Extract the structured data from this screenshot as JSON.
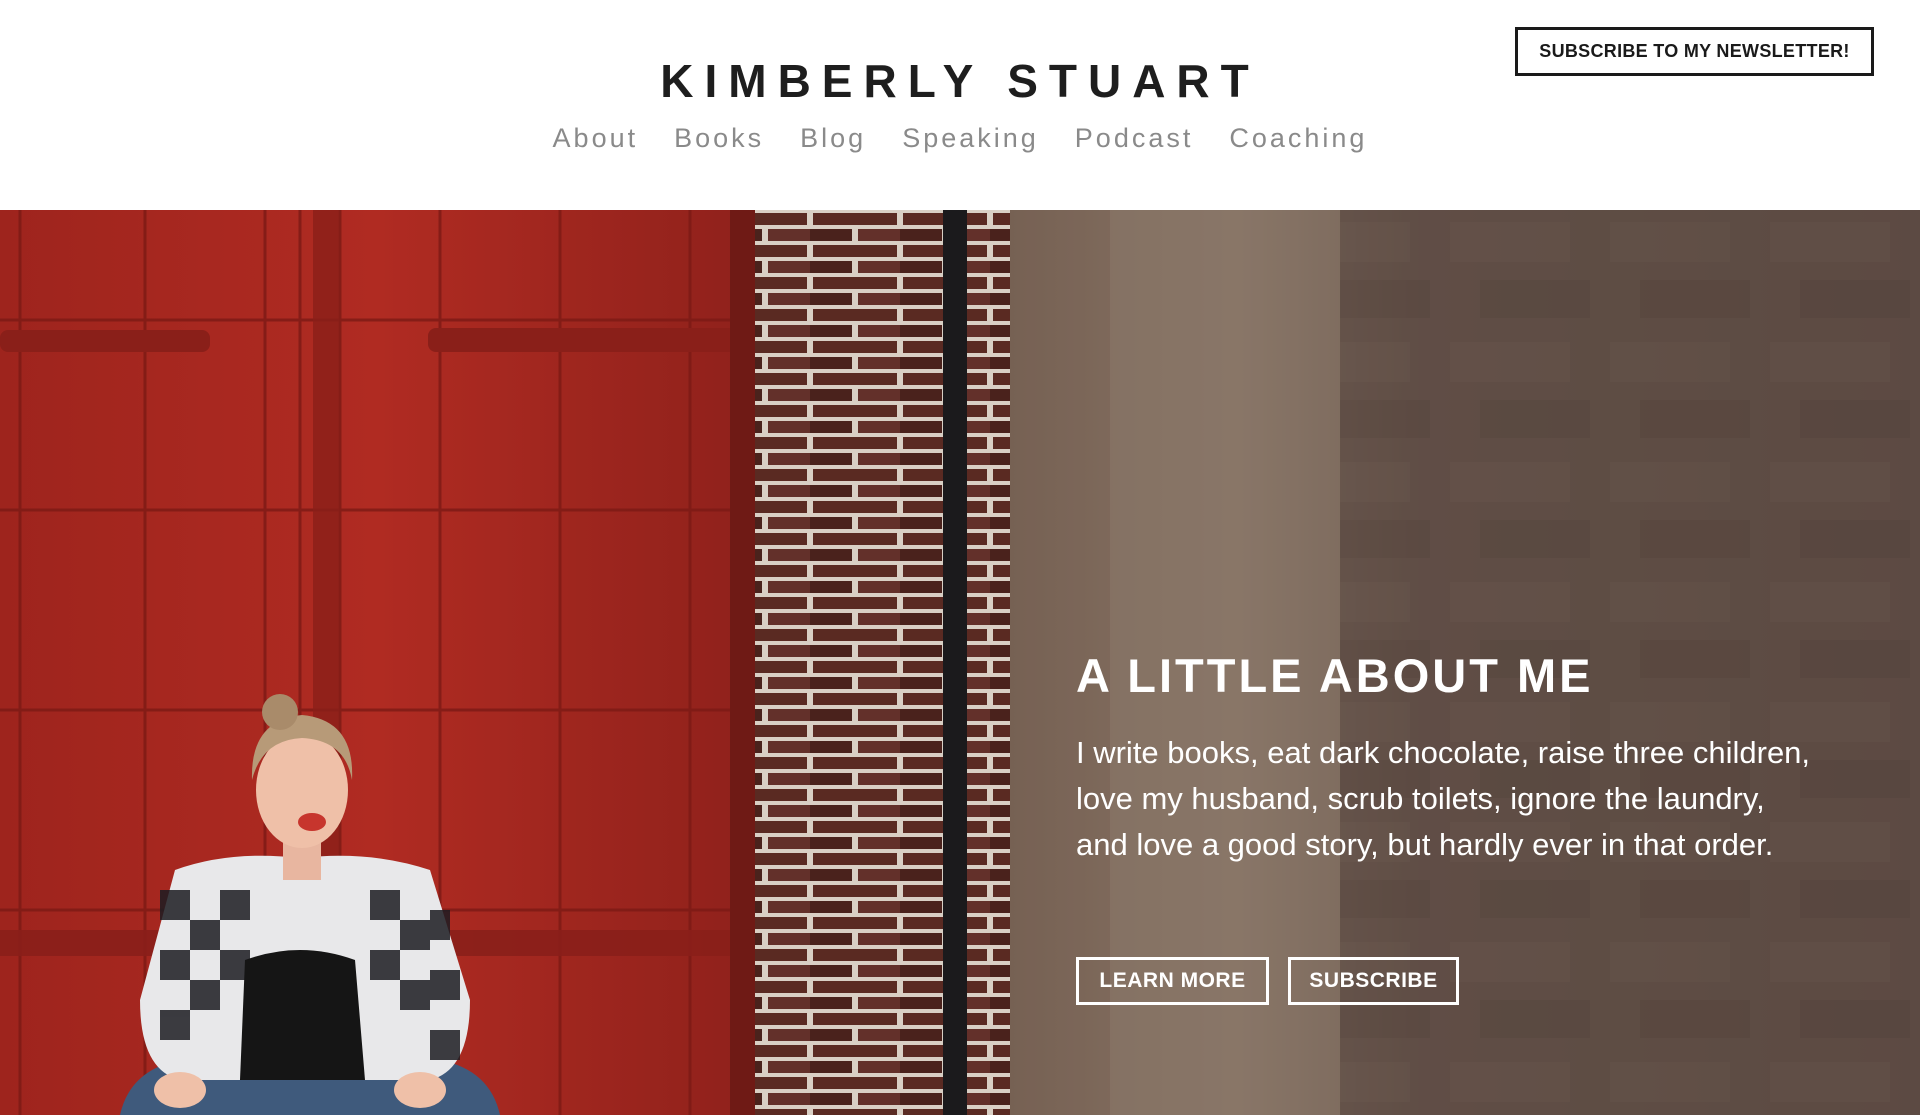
{
  "header": {
    "title": "KIMBERLY STUART",
    "nav": [
      "About",
      "Books",
      "Blog",
      "Speaking",
      "Podcast",
      "Coaching"
    ],
    "newsletter_label": "SUBSCRIBE TO MY NEWSLETTER!"
  },
  "hero": {
    "heading": "A LITTLE ABOUT ME",
    "text": "I write books, eat dark chocolate, raise three children, love my husband, scrub toilets, ignore the laundry, and love a good story, but hardly ever in that order.",
    "learn_more_label": "LEARN MORE",
    "subscribe_label": "SUBSCRIBE",
    "photo": "woman-laughing-by-red-door-photo"
  },
  "colors": {
    "title": "#1e1e1e",
    "nav": "#8a8a8a",
    "red_door": "#a8271f",
    "brick": "#5a2a22",
    "stone_blur": "#6e5a4f",
    "hero_text": "#ffffff"
  }
}
